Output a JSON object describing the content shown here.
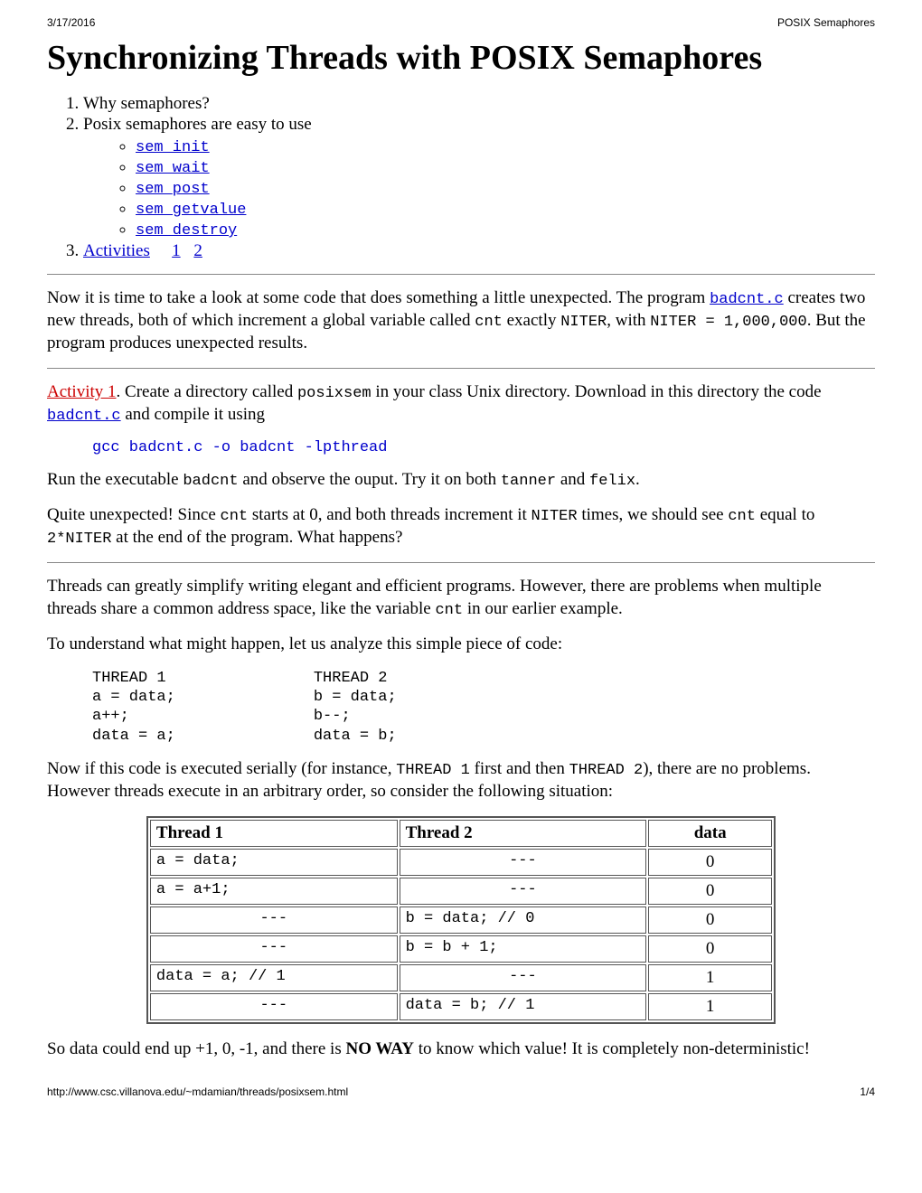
{
  "header": {
    "date": "3/17/2016",
    "title_small": "POSIX Semaphores"
  },
  "footer": {
    "url": "http://www.csc.villanova.edu/~mdamian/threads/posixsem.html",
    "page": "1/4"
  },
  "title": "Synchronizing Threads with POSIX Semaphores",
  "outline": {
    "li1": "Why semaphores?",
    "li2": "Posix semaphores are easy to use",
    "funcs": [
      "sem_init",
      "sem_wait",
      "sem_post",
      "sem_getvalue",
      "sem_destroy"
    ],
    "li3_label": "Activities",
    "act1": "1",
    "act2": "2"
  },
  "para1": {
    "t1": "Now it is time to take a look at some code that does something a little unexpected. The program ",
    "link": "badcnt.c",
    "t2": " creates two new threads, both of which increment a global variable called ",
    "cnt": "cnt",
    "t3": " exactly ",
    "niter": "NITER",
    "t4": ", with ",
    "eq": "NITER = 1,000,000",
    "t5": ". But the program produces unexpected results."
  },
  "activity1": {
    "label": "Activity 1",
    "t1": ". Create a directory called ",
    "dir": "posixsem",
    "t2": " in your class Unix directory. Download in this directory the code ",
    "link": "badcnt.c",
    "t3": " and compile it using"
  },
  "gcc_line": "gcc badcnt.c -o badcnt -lpthread",
  "run": {
    "t1": "Run the executable ",
    "exe": "badcnt",
    "t2": " and observe the ouput. Try it on both ",
    "h1": "tanner",
    "and": " and ",
    "h2": "felix",
    "t3": "."
  },
  "unexpected": {
    "t1": "Quite unexpected! Since ",
    "cnt": "cnt",
    "t2": " starts at 0, and both threads increment it ",
    "niter": "NITER",
    "t3": " times, we should see ",
    "cnt2": "cnt",
    "t4": " equal to ",
    "expr": "2*NITER",
    "t5": " at the end of the program. What happens?"
  },
  "threads_para": {
    "t1": "Threads can greatly simplify writing elegant and efficient programs. However, there are problems when multiple threads share a common address space, like the variable ",
    "cnt": "cnt",
    "t2": " in our earlier example."
  },
  "understand": "To understand what might happen, let us analyze this simple piece of code:",
  "codeblock": "THREAD 1                THREAD 2\na = data;               b = data;\na++;                    b--;\ndata = a;               data = b;",
  "serial": {
    "t1": "Now if this code is executed serially (for instance, ",
    "th1": "THREAD 1",
    "t2": " first and then ",
    "th2": "THREAD 2",
    "t3": "), there are no problems. However threads execute in an arbitrary order, so consider the following situation:"
  },
  "table": {
    "headers": [
      "Thread 1",
      "Thread 2",
      "data"
    ],
    "rows": [
      {
        "c1": "a = data;",
        "c2": "---",
        "d": "0",
        "a1": "left",
        "a2": "center"
      },
      {
        "c1": "a = a+1;",
        "c2": "---",
        "d": "0",
        "a1": "left",
        "a2": "center"
      },
      {
        "c1": "---",
        "c2": "b = data;  // 0",
        "d": "0",
        "a1": "center",
        "a2": "left"
      },
      {
        "c1": "---",
        "c2": "b = b + 1;",
        "d": "0",
        "a1": "center",
        "a2": "left"
      },
      {
        "c1": "data = a;  // 1",
        "c2": "---",
        "d": "1",
        "a1": "left",
        "a2": "center"
      },
      {
        "c1": "---",
        "c2": "data = b;  // 1",
        "d": "1",
        "a1": "center",
        "a2": "left"
      }
    ]
  },
  "conclusion": {
    "t1": "So data could end up +1, 0, -1, and there is ",
    "bold": "NO WAY",
    "t2": " to know which value! It is completely non-deterministic!"
  }
}
